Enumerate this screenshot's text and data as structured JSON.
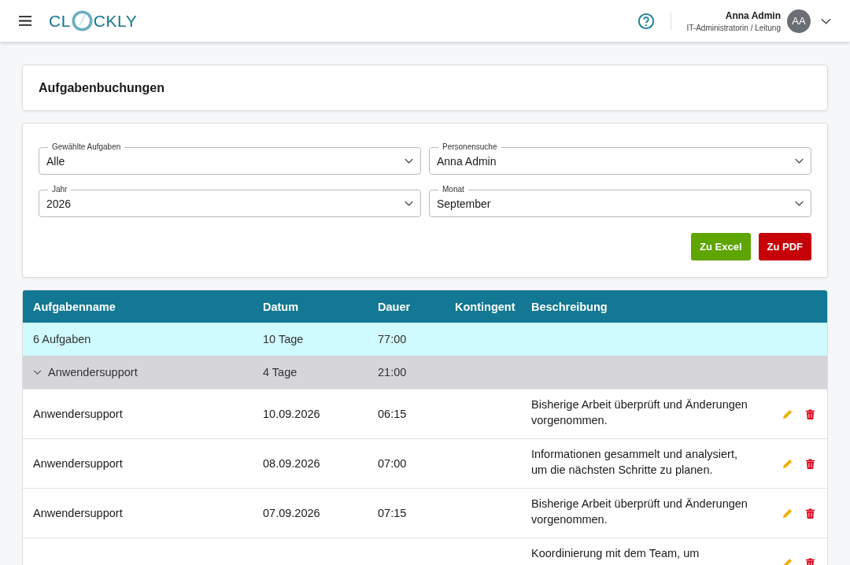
{
  "header": {
    "brand_before": "CL",
    "brand_after": "CKLY",
    "user_name": "Anna Admin",
    "user_role": "IT-Administratorin / Leitung",
    "avatar": "AA"
  },
  "page_title": "Aufgabenbuchungen",
  "filters": [
    {
      "label": "Gewählte Aufgaben",
      "value": "Alle"
    },
    {
      "label": "Personensuche",
      "value": "Anna Admin"
    },
    {
      "label": "Jahr",
      "value": "2026"
    },
    {
      "label": "Monat",
      "value": "September"
    }
  ],
  "buttons": [
    {
      "label": "Zu Excel",
      "kind": "excel"
    },
    {
      "label": "Zu PDF",
      "kind": "pdf"
    }
  ],
  "table": {
    "columns": [
      "Aufgabenname",
      "Datum",
      "Dauer",
      "Kontingent",
      "Beschreibung"
    ],
    "summary": {
      "name": "6 Aufgaben",
      "days": "10 Tage",
      "duration": "77:00"
    },
    "group": {
      "name": "Anwendersupport",
      "days": "4 Tage",
      "duration": "21:00",
      "expanded": true
    },
    "rows": [
      {
        "name": "Anwendersupport",
        "date": "10.09.2026",
        "duration": "06:15",
        "description": "Bisherige Arbeit überprüft und Änderungen vorgenommen."
      },
      {
        "name": "Anwendersupport",
        "date": "08.09.2026",
        "duration": "07:00",
        "description": "Informationen gesammelt und analysiert, um die nächsten Schritte zu planen."
      },
      {
        "name": "Anwendersupport",
        "date": "07.09.2026",
        "duration": "07:15",
        "description": "Bisherige Arbeit überprüft und Änderungen vorgenommen."
      },
      {
        "description": "Koordinierung mit dem Team, um"
      }
    ]
  }
}
